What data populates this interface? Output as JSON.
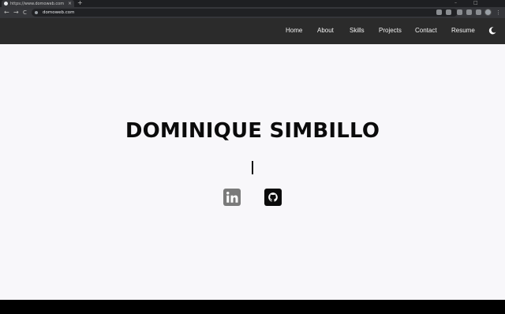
{
  "browser": {
    "tab_title": "https://www.domoweb.com",
    "tab_close": "×",
    "new_tab": "+",
    "url": "domoweb.com",
    "nav_back": "←",
    "nav_forward": "→",
    "nav_reload": "C",
    "window_controls": {
      "minimize": "–",
      "restore": "□"
    }
  },
  "nav": {
    "items": [
      {
        "label": "Home"
      },
      {
        "label": "About"
      },
      {
        "label": "Skills"
      },
      {
        "label": "Projects"
      },
      {
        "label": "Contact"
      },
      {
        "label": "Resume"
      }
    ],
    "theme_toggle_icon": "moon-icon"
  },
  "hero": {
    "name": "DOMINIQUE SIMBILLO",
    "social": [
      {
        "icon": "linkedin-icon",
        "color": "#7a7a7a"
      },
      {
        "icon": "github-icon",
        "color": "#0b0b0b"
      }
    ]
  },
  "colors": {
    "nav_bg": "#2b2b2b",
    "hero_bg": "#f8f7fa",
    "text": "#0b0b0b"
  }
}
